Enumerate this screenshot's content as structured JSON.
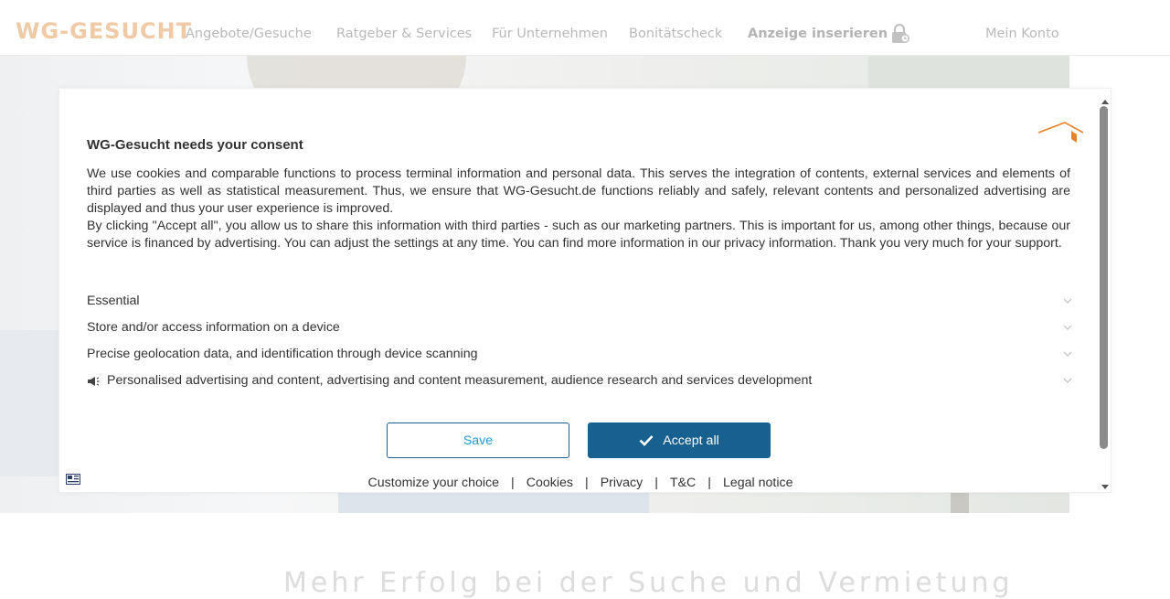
{
  "navbar": {
    "logo": "WG-GESUCHT",
    "links": {
      "offers": "Angebote/Gesuche",
      "guides": "Ratgeber & Services",
      "business": "Für Unternehmen",
      "credit": "Bonitätscheck",
      "post_ad": "Anzeige inserieren",
      "account": "Mein Konto"
    },
    "lock_icon": "lock-icon"
  },
  "background": {
    "headline_partial": "Mehr Erfolg bei der Suche und Vermietung"
  },
  "consent": {
    "title": "WG-Gesucht needs your consent",
    "paragraph1": "We use cookies and comparable functions to process terminal information and personal data. This serves the integration of contents, external services and elements of third parties as well as statistical measurement. Thus, we ensure that WG-Gesucht.de functions reliably and safely, relevant contents and personalized advertising are displayed and thus your user experience is improved.",
    "paragraph2": "By clicking \"Accept all\", you allow us to share this information with third parties - such as our marketing partners. This is important for us, among other things, because our service is financed by advertising. You can adjust the settings at any time. You can find more information in our privacy information. Thank you very much for your support.",
    "purposes": [
      {
        "label": "Essential",
        "icon": "chevron-down-icon"
      },
      {
        "label": "Store and/or access information on a device",
        "icon": "chevron-down-icon"
      },
      {
        "label": "Precise geolocation data, and identification through device scanning",
        "icon": "chevron-down-icon"
      },
      {
        "label": "Personalised advertising and content, advertising and content measurement, audience research and services development",
        "icon": "chevron-down-icon",
        "prefix_icon": "megaphone-icon"
      }
    ],
    "save_label": "Save",
    "accept_label": "Accept all",
    "footer_links": {
      "customize": "Customize your choice",
      "cookies": "Cookies",
      "privacy": "Privacy",
      "tc": "T&C",
      "legal": "Legal notice"
    },
    "separator": "|",
    "colors": {
      "accent": "#18608f",
      "save_text": "#1f9ad6",
      "brand_orange": "#e8822a",
      "logo_faded": "#f0c9a5"
    }
  }
}
